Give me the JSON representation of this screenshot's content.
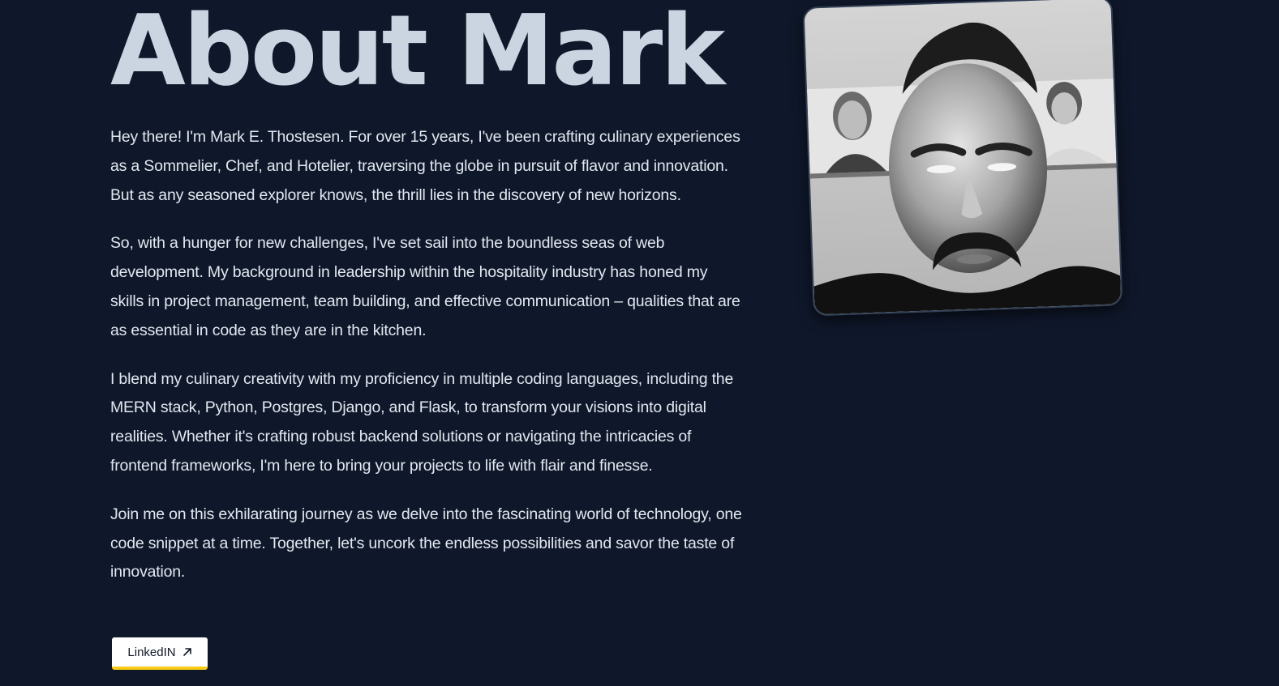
{
  "about": {
    "title": "About Mark",
    "paragraphs": [
      "Hey there! I'm Mark E. Thostesen. For over 15 years, I've been crafting culinary experiences as a Sommelier, Chef, and Hotelier, traversing the globe in pursuit of flavor and innovation. But as any seasoned explorer knows, the thrill lies in the discovery of new horizons.",
      "So, with a hunger for new challenges, I've set sail into the boundless seas of web development. My background in leadership within the hospitality industry has honed my skills in project management, team building, and effective communication – qualities that are as essential in code as they are in the kitchen.",
      "I blend my culinary creativity with my proficiency in multiple coding languages, including the MERN stack, Python, Postgres, Django, and Flask, to transform your visions into digital realities. Whether it's crafting robust backend solutions or navigating the intricacies of frontend frameworks, I'm here to bring your projects to life with flair and finesse.",
      "Join me on this exhilarating journey as we delve into the fascinating world of technology, one code snippet at a time. Together, let's uncork the endless possibilities and savor the taste of innovation."
    ],
    "linkedin_label": "LinkedIN",
    "linkedin_icon": "arrow-up-right-icon"
  },
  "colors": {
    "background": "#0f172a",
    "heading": "#cbd5e1",
    "text": "#e2e8f0",
    "button_bg": "#ffffff",
    "button_accent": "#facc15"
  }
}
